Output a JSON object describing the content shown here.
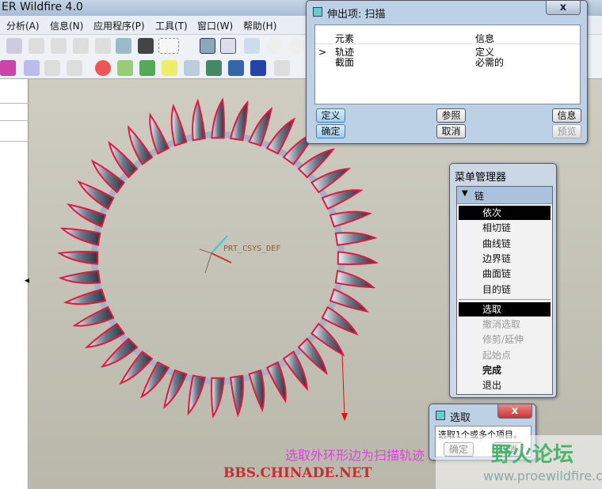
{
  "window": {
    "title": "ER Wildfire 4.0"
  },
  "menubar": [
    "分析(A)",
    "信息(N)",
    "应用程序(P)",
    "工具(T)",
    "窗口(W)",
    "帮助(H)"
  ],
  "viewport": {
    "csys_label": "PRT_CSYS_DEF"
  },
  "sweep_dialog": {
    "title": "伸出项: 扫描",
    "close": "x",
    "columns": [
      "元素",
      "信息"
    ],
    "rows": [
      {
        "marker": ">",
        "element": "轨迹",
        "info": "定义"
      },
      {
        "marker": "",
        "element": "截面",
        "info": "必需的"
      }
    ],
    "buttons": {
      "define": "定义",
      "reference": "参照",
      "info": "信息",
      "ok": "确定",
      "cancel": "取消",
      "preview": "预览"
    }
  },
  "menu_manager": {
    "title": "菜单管理器",
    "section": "链",
    "group1": [
      {
        "label": "依次",
        "state": "selected"
      },
      {
        "label": "相切链"
      },
      {
        "label": "曲线链"
      },
      {
        "label": "边界链"
      },
      {
        "label": "曲面链"
      },
      {
        "label": "目的链"
      }
    ],
    "group2": [
      {
        "label": "选取",
        "state": "selected"
      },
      {
        "label": "撤消选取",
        "state": "disabled"
      },
      {
        "label": "修剪/延伸",
        "state": "disabled"
      },
      {
        "label": "起始点",
        "state": "disabled"
      },
      {
        "label": "完成",
        "state": "bold"
      },
      {
        "label": "退出"
      }
    ]
  },
  "select_dialog": {
    "title": "选取",
    "close": "x",
    "message": "选取1个或多个项目。",
    "ok": "确定",
    "cancel": "取消"
  },
  "annotation": "选取外环形边为扫描轨迹",
  "watermarks": {
    "left": "BBS.CHINADE.NET",
    "right_title": "野火论坛",
    "right_url": "www.proewildfire.cn"
  },
  "colors": {
    "trajectory": "#e8163c",
    "accent": "#3c7fb1"
  }
}
